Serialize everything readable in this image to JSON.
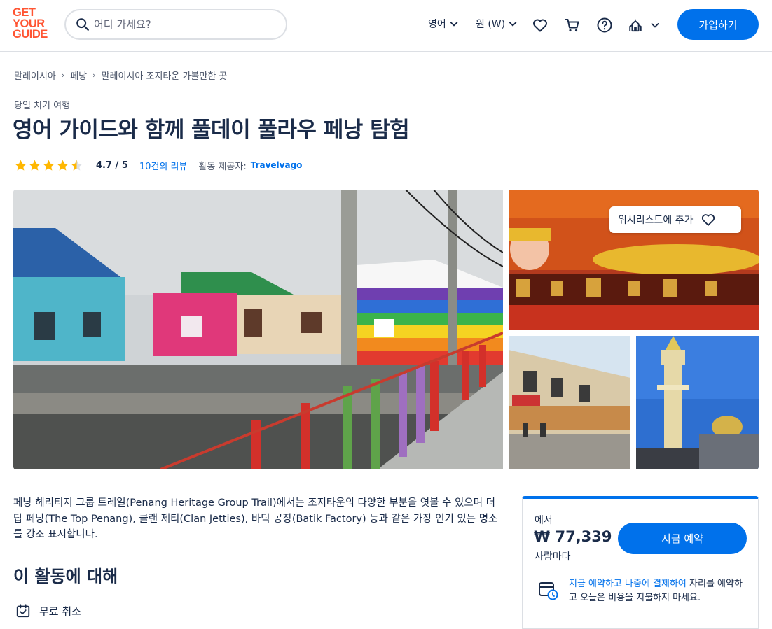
{
  "header": {
    "logo_lines": [
      "GET",
      "YOUR",
      "GUIDE"
    ],
    "search_placeholder": "어디 가세요?",
    "language": "영어",
    "currency": "원 (W)",
    "signup_label": "가입하기",
    "icons": [
      "search-icon",
      "chevron-down-icon",
      "heart-icon",
      "cart-icon",
      "help-icon",
      "account-icon"
    ]
  },
  "breadcrumb": [
    "말레이시아",
    "페낭",
    "말레이시아 조지타운 가볼만한 곳"
  ],
  "activity": {
    "category": "당일 치기 여행",
    "title": "영어 가이드와 함께 풀데이 풀라우 페낭 탐험",
    "rating_stars": 4.5,
    "rating_text": "4.7 / 5",
    "reviews_link": "10건의 리뷰",
    "provider_label": "활동 제공자:",
    "provider_name": "Travelvago"
  },
  "gallery": {
    "wishlist_label": "위시리스트에 추가",
    "images": [
      "colorful-stilt-houses-photo",
      "reclining-buddha-photo",
      "shophouse-street-photo",
      "mosque-minaret-photo"
    ]
  },
  "description": "페낭 헤리티지 그룹 트레일(Penang Heritage Group Trail)에서는 조지타운의 다양한 부분을 엿볼 수 있으며 더 탑 페낭(The Top Penang), 클랜 제티(Clan Jetties), 바틱 공장(Batik Factory) 등과 같은 가장 인기 있는 명소를 강조 표시합니다.",
  "about": {
    "title": "이 활동에 대해",
    "features": [
      "무료 취소"
    ]
  },
  "booking": {
    "from_label": "에서",
    "price": "₩ 77,339",
    "per_person": "사람마다",
    "book_button": "지금 예약",
    "reserve_link": "지금 예약하고 나중에 결제하여",
    "reserve_text": " 자리를 예약하고 오늘은 비용을 지불하지 마세요."
  },
  "colors": {
    "primary": "#0071eb",
    "brand": "#ff5533",
    "text": "#1a2b49",
    "star": "#ffb700"
  }
}
